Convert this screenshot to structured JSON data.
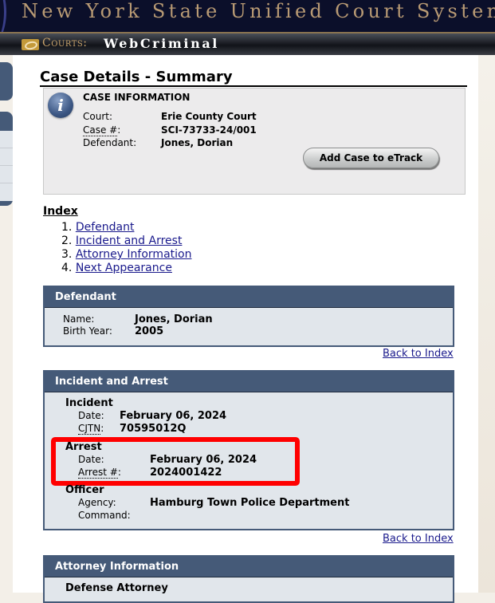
{
  "banner": {
    "title": "New York State Unified Court System",
    "courts_label": "Courts:",
    "app_name": "WebCriminal"
  },
  "page": {
    "title": "Case Details - Summary"
  },
  "case_info": {
    "heading": "CASE INFORMATION",
    "court_label": "Court:",
    "court_value": "Erie County Court",
    "case_label": "Case #",
    "case_colon": ":",
    "case_value": "SCI-73733-24/001",
    "defendant_label": "Defendant:",
    "defendant_value": "Jones, Dorian",
    "add_button": "Add Case to eTrack",
    "icon": "info-icon"
  },
  "index": {
    "title": "Index",
    "items": [
      {
        "num": "1.",
        "label": "Defendant"
      },
      {
        "num": "2.",
        "label": "Incident and Arrest"
      },
      {
        "num": "3.",
        "label": "Attorney Information"
      },
      {
        "num": "4.",
        "label": "Next Appearance"
      }
    ]
  },
  "defendant": {
    "heading": "Defendant",
    "name_label": "Name:",
    "name_value": "Jones, Dorian",
    "birth_label": "Birth Year:",
    "birth_value": "2005",
    "back": "Back to Index"
  },
  "incident_arrest": {
    "heading": "Incident and Arrest",
    "incident": {
      "title": "Incident",
      "date_label": "Date:",
      "date_value": "February 06, 2024",
      "cjtn_label": "CJTN",
      "cjtn_colon": ":",
      "cjtn_value": "70595012Q"
    },
    "arrest": {
      "title": "Arrest",
      "date_label": "Date:",
      "date_value": "February 06, 2024",
      "num_label": "Arrest #",
      "num_colon": ":",
      "num_value": "2024001422"
    },
    "officer": {
      "title": "Officer",
      "agency_label": "Agency:",
      "agency_value": "Hamburg Town Police Department",
      "command_label": "Command:",
      "command_value": ""
    },
    "back": "Back to Index"
  },
  "attorney": {
    "heading": "Attorney Information",
    "sub_title": "Defense Attorney"
  },
  "colors": {
    "section_header": "#455a78",
    "section_body": "#e1e6eb",
    "link": "#1a1a8c",
    "highlight": "#ff0000"
  }
}
